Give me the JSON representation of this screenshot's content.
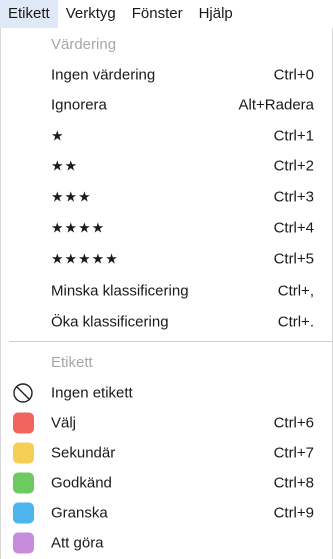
{
  "menubar": {
    "items": [
      {
        "label": "Etikett",
        "active": true
      },
      {
        "label": "Verktyg"
      },
      {
        "label": "Fönster"
      },
      {
        "label": "Hjälp"
      }
    ]
  },
  "rating_menu": {
    "header": "Värdering",
    "items": [
      {
        "label": "Ingen värdering",
        "shortcut": "Ctrl+0"
      },
      {
        "label": "Ignorera",
        "shortcut": "Alt+Radera"
      },
      {
        "label": "★",
        "shortcut": "Ctrl+1"
      },
      {
        "label": "★★",
        "shortcut": "Ctrl+2"
      },
      {
        "label": "★★★",
        "shortcut": "Ctrl+3"
      },
      {
        "label": "★★★★",
        "shortcut": "Ctrl+4"
      },
      {
        "label": "★★★★★",
        "shortcut": "Ctrl+5"
      },
      {
        "label": "Minska klassificering",
        "shortcut": "Ctrl+,"
      },
      {
        "label": "Öka klassificering",
        "shortcut": "Ctrl+."
      }
    ]
  },
  "label_menu": {
    "header": "Etikett",
    "items": [
      {
        "label": "Ingen etikett",
        "shortcut": "",
        "icon": "no-label-icon"
      },
      {
        "label": "Välj",
        "shortcut": "Ctrl+6",
        "color": "#f2655f",
        "icon": "red-swatch-icon"
      },
      {
        "label": "Sekundär",
        "shortcut": "Ctrl+7",
        "color": "#f3d054",
        "icon": "yellow-swatch-icon"
      },
      {
        "label": "Godkänd",
        "shortcut": "Ctrl+8",
        "color": "#6ccb5f",
        "icon": "green-swatch-icon"
      },
      {
        "label": "Granska",
        "shortcut": "Ctrl+9",
        "color": "#4cb5f0",
        "icon": "blue-swatch-icon"
      },
      {
        "label": "Att göra",
        "shortcut": "",
        "color": "#c78ddc",
        "icon": "purple-swatch-icon"
      }
    ]
  },
  "colors": {
    "active_menu_bg": "#dfe8f6",
    "header_text": "#a8a8a8",
    "divider": "#d0d0d0"
  }
}
